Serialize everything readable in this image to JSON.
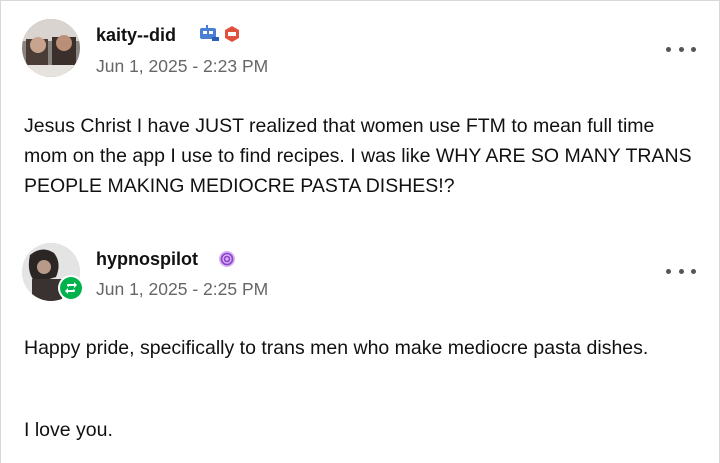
{
  "posts": [
    {
      "username": "kaity--did",
      "timestamp": "Jun 1, 2025 - 2:23 PM",
      "badges": [
        "robot-badge-icon",
        "devil-badge-icon"
      ],
      "paragraphs": [
        "Jesus Christ I have JUST realized that women use FTM to mean full time mom on the app I use to find recipes. I was like WHY ARE SO MANY TRANS PEOPLE MAKING MEDIOCRE PASTA DISHES!?"
      ]
    },
    {
      "username": "hypnospilot",
      "timestamp": "Jun 1, 2025 - 2:25 PM",
      "badges": [
        "spiral-badge-icon"
      ],
      "reblog_icon": "reblog-icon",
      "paragraphs": [
        "Happy pride, specifically to trans men who make mediocre pasta dishes.",
        "I love you."
      ]
    }
  ],
  "colors": {
    "reblog_green": "#00b24b",
    "timestamp_gray": "#666666",
    "border": "#d8d8d8"
  }
}
